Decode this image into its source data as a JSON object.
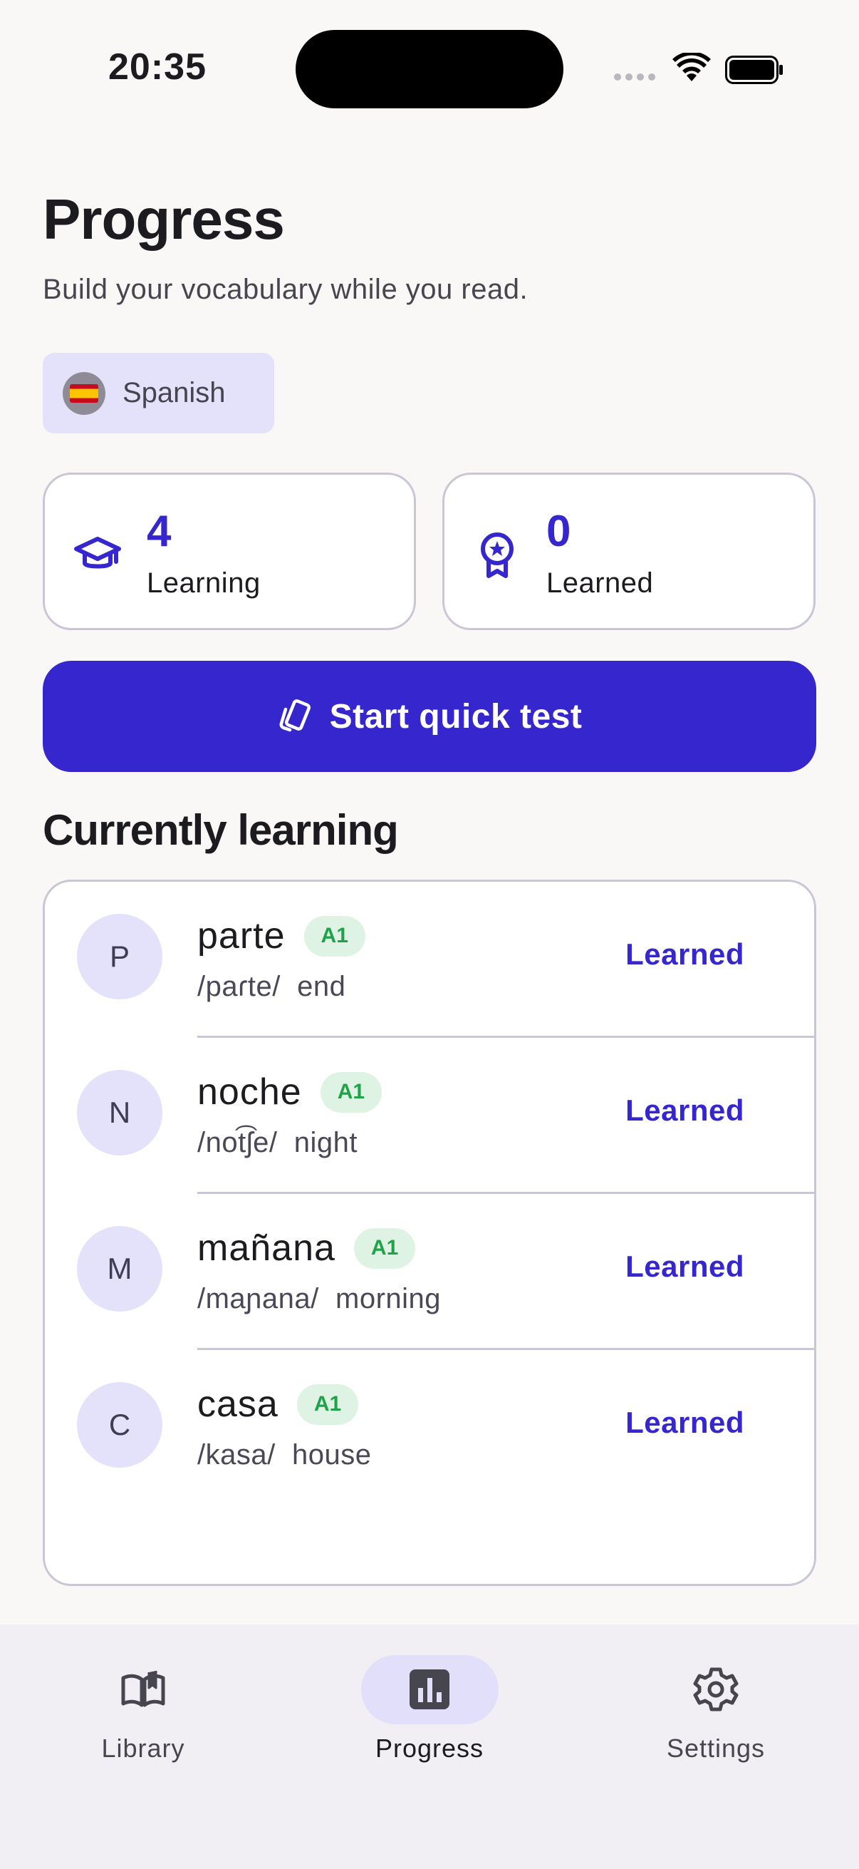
{
  "status_bar": {
    "time": "20:35"
  },
  "header": {
    "title": "Progress",
    "subtitle": "Build your vocabulary while you read."
  },
  "language": {
    "label": "Spanish",
    "flag_icon": "spain-flag-icon"
  },
  "stats": {
    "learning": {
      "value": "4",
      "label": "Learning",
      "icon": "graduation-cap-icon"
    },
    "learned": {
      "value": "0",
      "label": "Learned",
      "icon": "award-badge-icon"
    }
  },
  "quick_test": {
    "label": "Start quick test",
    "icon": "flashcards-icon"
  },
  "section": {
    "title": "Currently learning"
  },
  "words": [
    {
      "initial": "P",
      "word": "parte",
      "level": "A1",
      "pronunciation": "/paɾte/",
      "translation": "end",
      "action": "Learned"
    },
    {
      "initial": "N",
      "word": "noche",
      "level": "A1",
      "pronunciation": "/not͡ʃe/",
      "translation": "night",
      "action": "Learned"
    },
    {
      "initial": "M",
      "word": "mañana",
      "level": "A1",
      "pronunciation": "/maɲana/",
      "translation": "morning",
      "action": "Learned"
    },
    {
      "initial": "C",
      "word": "casa",
      "level": "A1",
      "pronunciation": "/kasa/",
      "translation": "house",
      "action": "Learned"
    }
  ],
  "nav": {
    "library": "Library",
    "progress": "Progress",
    "settings": "Settings",
    "active": "progress"
  },
  "colors": {
    "accent": "#3626ce",
    "accent_container": "#e4e1fb",
    "level_bg": "#dff3e4",
    "level_text": "#20a24a"
  }
}
